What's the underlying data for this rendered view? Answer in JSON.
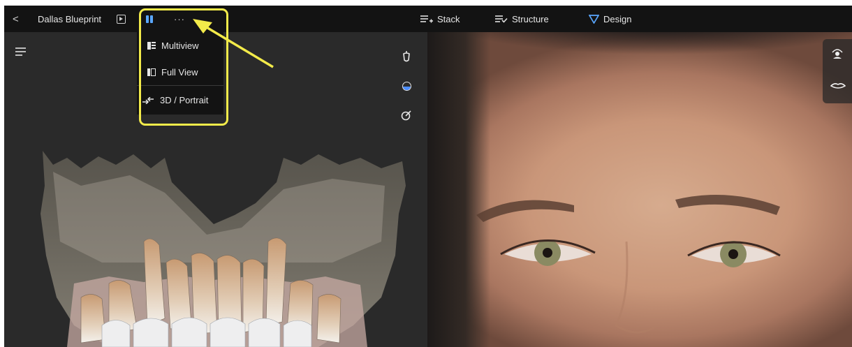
{
  "toolbar": {
    "back_label": "<",
    "title": "Dallas Blueprint",
    "more_label": "···",
    "nav": [
      {
        "label": "Stack",
        "icon": "stack-add-icon"
      },
      {
        "label": "Structure",
        "icon": "structure-check-icon"
      },
      {
        "label": "Design",
        "icon": "design-triangle-icon"
      }
    ]
  },
  "menu": {
    "items": [
      {
        "label": "Multiview",
        "icon": "multiview-icon"
      },
      {
        "label": "Full View",
        "icon": "full-view-icon"
      },
      {
        "label": "3D / Portrait",
        "icon": "swap-arrows-icon"
      }
    ]
  },
  "left_tools": [
    "implant-icon",
    "half-circle-icon",
    "compass-icon"
  ],
  "right_tools": [
    "face-rotate-icon",
    "lip-icon"
  ],
  "colors": {
    "toolbar_bg": "#131313",
    "viewport_bg": "#2a2a2a",
    "accent_blue": "#5aa7ff",
    "highlight_yellow": "#f3eb4a"
  }
}
